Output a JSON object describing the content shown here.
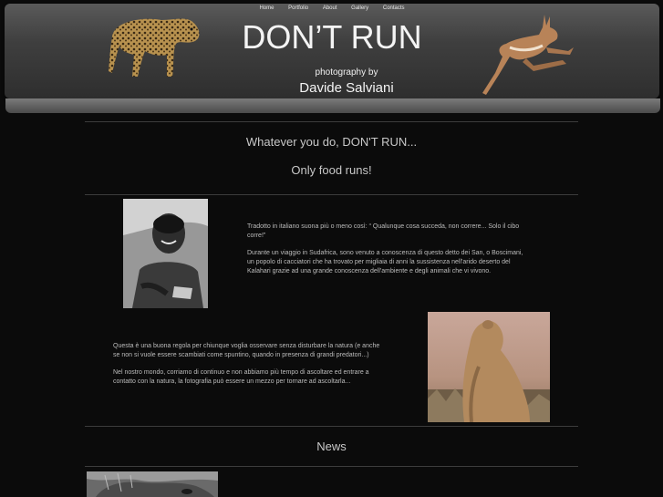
{
  "nav": {
    "items": [
      "Home",
      "Portfolio",
      "About",
      "Gallery",
      "Contacts"
    ]
  },
  "header": {
    "title": "DON’T RUN",
    "subtitle": "photography by",
    "author": "Davide Salviani"
  },
  "intro": {
    "line1": "Whatever you do, DON'T RUN...",
    "line2": "Only food runs!"
  },
  "section1": {
    "p1": "Tradotto in italiano suona più o meno così: “ Qualunque cosa succeda, non correre... Solo il cibo corre!”",
    "p2": "Durante un viaggio in Sudafrica, sono venuto a conoscenza di questo detto dei San, o Boscimani, un popolo di cacciatori che ha trovato per migliaia di anni la sussistenza nell'arido deserto del Kalahari grazie ad una grande conoscenza dell'ambiente e degli animali che vi vivono."
  },
  "section2": {
    "p1": "Questa è una buona regola per chiunque voglia osservare senza disturbare la natura (e anche se non si vuole essere scambiati come spuntino, quando in presenza di grandi predatori...)",
    "p2": "Nel nostro mondo, corriamo di continuo e non abbiamo più tempo di ascoltare ed entrare a contatto con la natura, la fotografia può essere un mezzo per tornare ad ascoltarla..."
  },
  "news": {
    "heading": "News"
  },
  "colors": {
    "background": "#0b0b0b",
    "header": "#3f3f3f",
    "text": "#bcbcbc"
  }
}
